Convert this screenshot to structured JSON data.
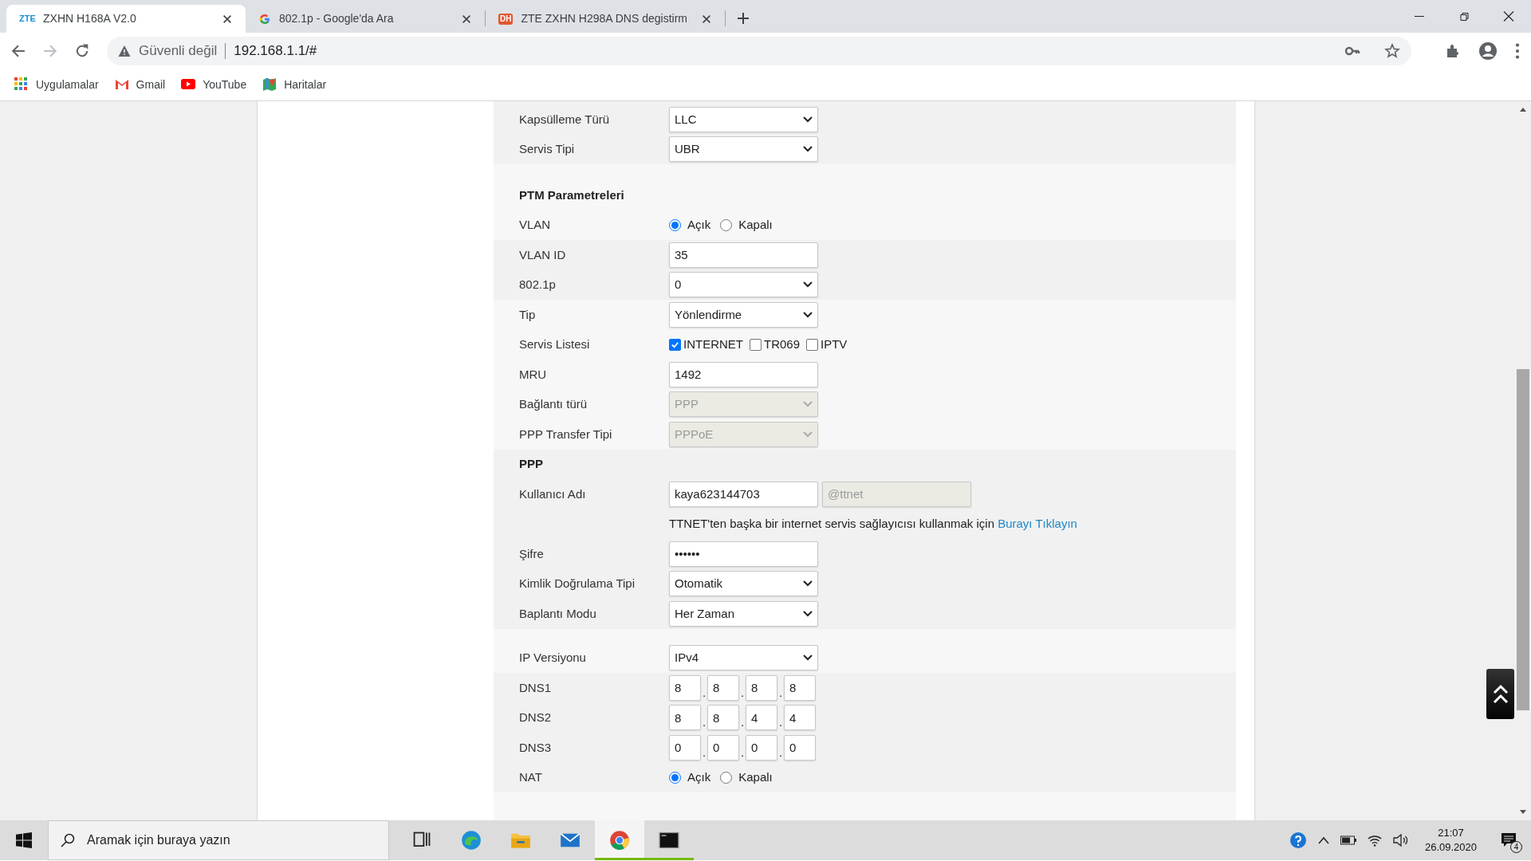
{
  "browser": {
    "tabs": [
      {
        "kind": "zte",
        "icon_text": "ZTE",
        "title": "ZXHN H168A V2.0",
        "selected": true
      },
      {
        "kind": "google",
        "title": "802.1p - Google'da Ara",
        "selected": false
      },
      {
        "kind": "dh",
        "icon_text": "DH",
        "title": "ZTE ZXHN H298A DNS degistirm",
        "selected": false
      }
    ],
    "address": {
      "security": "Güvenli değil",
      "url": "192.168.1.1/#"
    },
    "bookmarks": [
      {
        "kind": "apps",
        "label": "Uygulamalar"
      },
      {
        "kind": "gmail",
        "label": "Gmail"
      },
      {
        "kind": "youtube",
        "label": "YouTube"
      },
      {
        "kind": "maps",
        "label": "Haritalar"
      }
    ]
  },
  "form": {
    "sections": [
      {
        "rows": [
          {
            "kind": "select",
            "label": "Kapsülleme Türü",
            "value": "LLC",
            "disabled": false
          },
          {
            "kind": "select",
            "label": "Servis Tipi",
            "value": "UBR",
            "disabled": false
          }
        ]
      },
      {
        "rows": [
          {
            "kind": "heading",
            "text": "PTM Parametreleri"
          },
          {
            "kind": "radio",
            "label": "VLAN",
            "options": [
              {
                "label": "Açık",
                "selected": true
              },
              {
                "label": "Kapalı",
                "selected": false
              }
            ]
          }
        ]
      },
      {
        "rows": [
          {
            "kind": "text",
            "label": "VLAN ID",
            "value": "35"
          },
          {
            "kind": "select",
            "label": "802.1p",
            "value": "0",
            "disabled": false
          }
        ]
      },
      {
        "rows": [
          {
            "kind": "select",
            "label": "Tip",
            "value": "Yönlendirme",
            "disabled": false
          },
          {
            "kind": "checkboxes",
            "label": "Servis Listesi",
            "options": [
              {
                "label": "INTERNET",
                "checked": true
              },
              {
                "label": "TR069",
                "checked": false
              },
              {
                "label": "IPTV",
                "checked": false
              }
            ]
          },
          {
            "kind": "text",
            "label": "MRU",
            "value": "1492"
          },
          {
            "kind": "select",
            "label": "Bağlantı türü",
            "value": "PPP",
            "disabled": true
          },
          {
            "kind": "select",
            "label": "PPP Transfer Tipi",
            "value": "PPPoE",
            "disabled": true
          }
        ]
      },
      {
        "rows": [
          {
            "kind": "heading",
            "text": "PPP"
          },
          {
            "kind": "user",
            "label": "Kullanıcı Adı",
            "value": "kaya623144703",
            "suffix": "@ttnet"
          },
          {
            "kind": "hint",
            "text": "TTNET'ten başka bir internet servis sağlayıcısı kullanmak için",
            "link": "Burayı Tıklayın"
          },
          {
            "kind": "text",
            "label": "Şifre",
            "value": "••••••"
          },
          {
            "kind": "select",
            "label": "Kimlik Doğrulama Tipi",
            "value": "Otomatik",
            "disabled": false
          },
          {
            "kind": "select",
            "label": "Baplantı Modu",
            "value": "Her Zaman",
            "disabled": false
          }
        ]
      },
      {
        "rows": [
          {
            "kind": "select",
            "label": "IP Versiyonu",
            "value": "IPv4",
            "disabled": false
          }
        ]
      },
      {
        "rows": [
          {
            "kind": "dns",
            "label": "DNS1",
            "octets": [
              "8",
              "8",
              "8",
              "8"
            ],
            "separators": [
              ".",
              ".",
              "."
            ]
          },
          {
            "kind": "dns",
            "label": "DNS2",
            "octets": [
              "8",
              "8",
              "4",
              "4"
            ],
            "separators": [
              ".",
              ".",
              "."
            ]
          },
          {
            "kind": "dns",
            "label": "DNS3",
            "octets": [
              "0",
              "0",
              "0",
              "0"
            ],
            "separators": [
              ".",
              ".",
              "."
            ]
          },
          {
            "kind": "radio",
            "label": "NAT",
            "options": [
              {
                "label": "Açık",
                "selected": true
              },
              {
                "label": "Kapalı",
                "selected": false
              }
            ]
          }
        ]
      }
    ]
  },
  "taskbar": {
    "search": {
      "placeholder": "Aramak için buraya yazın"
    },
    "apps": [
      {
        "kind": "taskview",
        "running": false,
        "selected": false
      },
      {
        "kind": "edge",
        "running": false,
        "selected": false
      },
      {
        "kind": "explorer",
        "running": false,
        "selected": false
      },
      {
        "kind": "mail",
        "running": false,
        "selected": false
      },
      {
        "kind": "chrome",
        "running": true,
        "selected": true
      },
      {
        "kind": "terminal",
        "running": true,
        "selected": false
      }
    ],
    "time": "21:07",
    "date": "26.09.2020",
    "notifications": "4"
  }
}
